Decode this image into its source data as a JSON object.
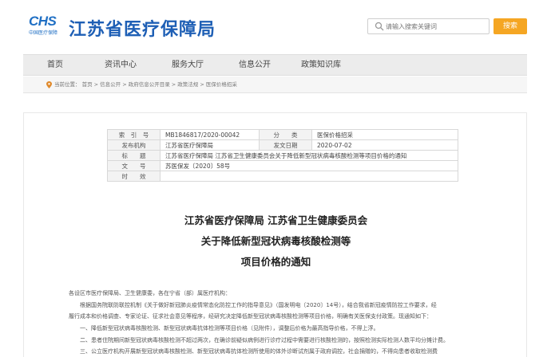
{
  "header": {
    "logo_text": "CHS",
    "logo_subtext": "中国医疗保障",
    "site_title": "江苏省医疗保障局",
    "search_placeholder": "请输入搜索关键词",
    "search_button": "搜索"
  },
  "nav": {
    "items": [
      "首页",
      "资讯中心",
      "服务大厅",
      "信息公开",
      "政策知识库"
    ]
  },
  "breadcrumb": {
    "text": "当前位置： 首页 > 信息公开 > 政府信息公开目录 > 政策法规 > 医保价格招采"
  },
  "meta": {
    "index_label": "索　引　号",
    "index_value": "MB1846817/2020-00042",
    "category_label": "分　　类",
    "category_value": "医保价格招采",
    "issuer_label": "发布机构",
    "issuer_value": "江苏省医疗保障局",
    "date_label": "发文日期",
    "date_value": "2020-07-02",
    "title_label": "标　　题",
    "title_value": "江苏省医疗保障局 江苏省卫生健康委员会关于降低新型冠状病毒核酸检测等项目价格的通知",
    "docno_label": "文　　号",
    "docno_value": "苏医保发〔2020〕58号",
    "validity_label": "时　　效",
    "validity_value": ""
  },
  "document": {
    "title_line1": "江苏省医疗保障局 江苏省卫生健康委员会",
    "title_line2": "关于降低新型冠状病毒核酸检测等",
    "title_line3": "项目价格的通知",
    "paragraphs": [
      "各设区市医疗保障局、卫生健康委，各在宁省（部）属医疗机构：",
      "　　根据国务院联防联控机制《关于做好新冠肺炎疫情常态化防控工作的指导意见》（国发明电〔2020〕14号），结合我省新冠疫情防控工作要求，经",
      "履行成本和价格调查、专家论证、征求社会意见等程序，经研究决定降低新型冠状病毒核酸检测等项目价格，明确有关医保支付政策。现通知如下：",
      "　　一、降低新型冠状病毒核酸检测、新型冠状病毒抗体检测等项目价格（见附件），调整后价格为最高指导价格，不得上浮。",
      "　　二、患者住院期间新型冠状病毒核酸检测不超过两次，在确诊前疑似病例进行诊疗过程中需要进行核酸检测的，按照检测实际检测人数平均分摊计费。",
      "　　三、公立医疗机构开展新型冠状病毒核酸检测、新型冠状病毒抗体检测所使用的体外诊断试剂属于政府调控，社会捐赠的，不得向患者收取检测费"
    ]
  }
}
